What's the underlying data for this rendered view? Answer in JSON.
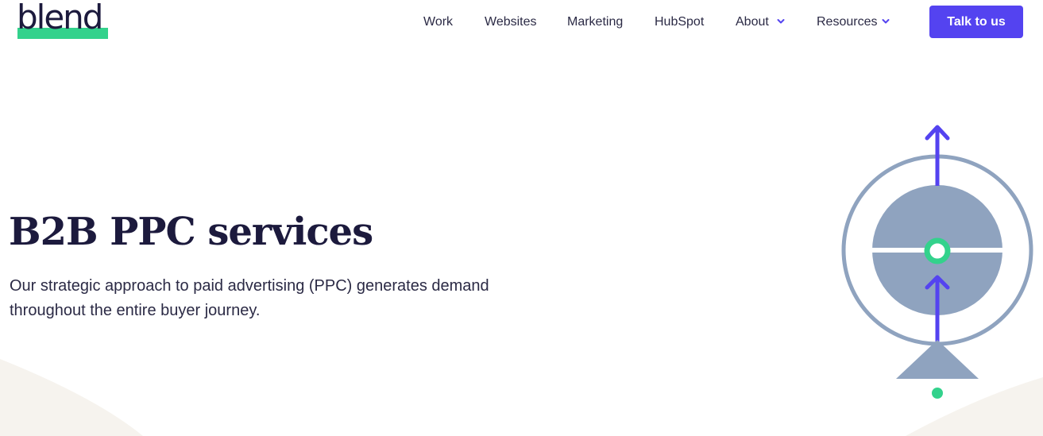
{
  "brand": {
    "logo_text": "blend"
  },
  "nav": {
    "items": [
      {
        "label": "Work",
        "has_dropdown": false
      },
      {
        "label": "Websites",
        "has_dropdown": false
      },
      {
        "label": "Marketing",
        "has_dropdown": false
      },
      {
        "label": "HubSpot",
        "has_dropdown": false
      },
      {
        "label": "About",
        "has_dropdown": true
      },
      {
        "label": "Resources",
        "has_dropdown": true
      }
    ],
    "cta_label": "Talk to us"
  },
  "hero": {
    "title": "B2B PPC services",
    "subtitle_line1": "Our strategic approach to paid advertising (PPC) generates demand",
    "subtitle_line2": "throughout the entire buyer journey."
  },
  "colors": {
    "brand_green": "#33d28c",
    "cta_purple": "#5443f0",
    "text_navy": "#1c1a3d",
    "illustration_slate": "#8fa3bf",
    "background_curve": "#f6f3ee"
  },
  "icons": {
    "dropdown": "chevron-down-icon",
    "illustration": "compass-arrow-illustration"
  }
}
